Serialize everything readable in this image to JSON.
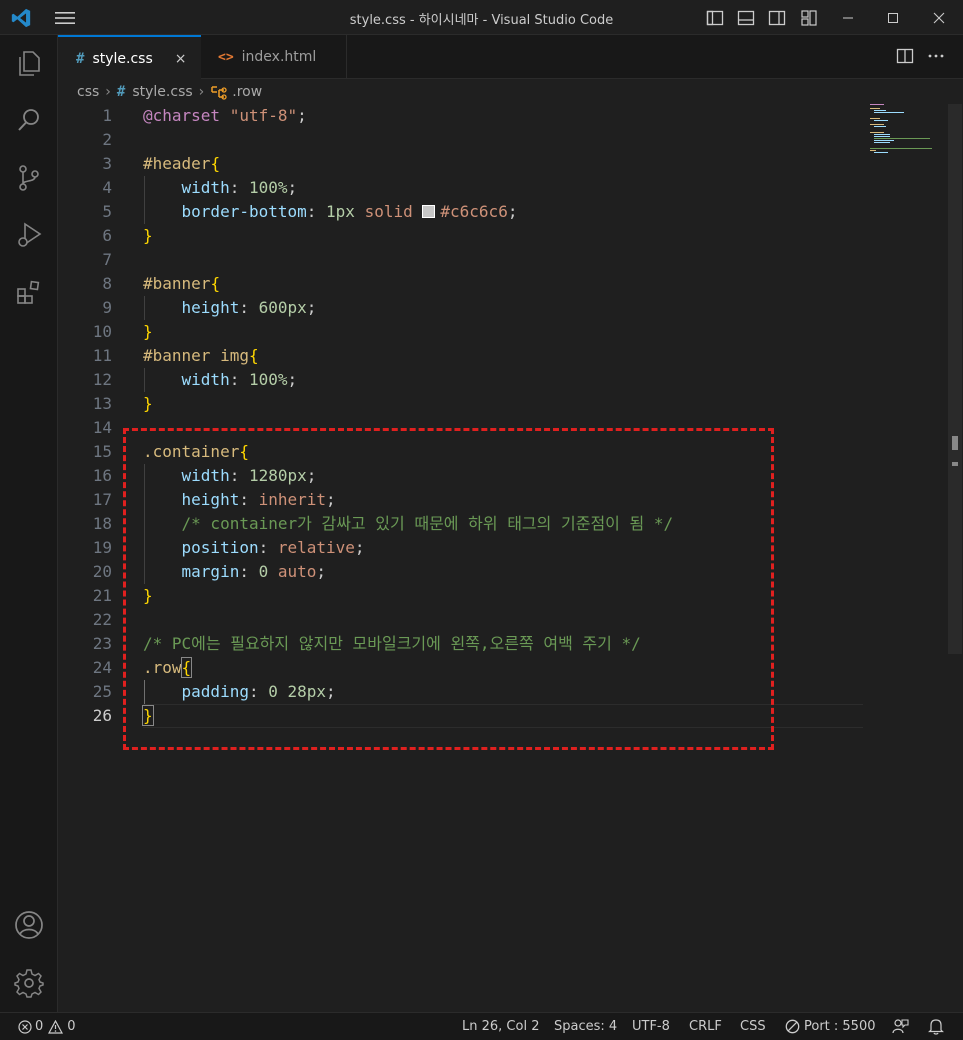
{
  "window": {
    "title": "style.css - 하이시네마 - Visual Studio Code"
  },
  "icons": {
    "app": "vscode-logo-icon",
    "menu": "hamburger-menu-icon",
    "layout": [
      "toggle-primary-sidebar-icon",
      "toggle-panel-icon",
      "toggle-secondary-sidebar-icon",
      "customize-layout-icon"
    ],
    "window": [
      "minimize-icon",
      "maximize-icon",
      "close-icon"
    ],
    "activity": [
      "explorer-icon",
      "search-icon",
      "source-control-icon",
      "run-debug-icon",
      "extensions-icon"
    ],
    "activity_bottom": [
      "accounts-icon",
      "settings-gear-icon"
    ]
  },
  "tabs": [
    {
      "icon": "#",
      "label": "style.css",
      "close": "×",
      "active": true
    },
    {
      "icon": "<>",
      "label": "index.html",
      "active": false
    }
  ],
  "breadcrumb": {
    "folder": "css",
    "file_icon": "#",
    "file": "style.css",
    "symbol": ".row"
  },
  "editor": {
    "current_line": 26,
    "lines": [
      {
        "n": "1"
      },
      {
        "n": "2"
      },
      {
        "n": "3"
      },
      {
        "n": "4"
      },
      {
        "n": "5"
      },
      {
        "n": "6"
      },
      {
        "n": "7"
      },
      {
        "n": "8"
      },
      {
        "n": "9"
      },
      {
        "n": "10"
      },
      {
        "n": "11"
      },
      {
        "n": "12"
      },
      {
        "n": "13"
      },
      {
        "n": "14"
      },
      {
        "n": "15"
      },
      {
        "n": "16"
      },
      {
        "n": "17"
      },
      {
        "n": "18"
      },
      {
        "n": "19"
      },
      {
        "n": "20"
      },
      {
        "n": "21"
      },
      {
        "n": "22"
      },
      {
        "n": "23"
      },
      {
        "n": "24"
      },
      {
        "n": "25"
      },
      {
        "n": "26"
      }
    ],
    "code": {
      "l1": {
        "at": "@charset",
        "sp": " ",
        "str": "\"utf-8\"",
        "end": ";"
      },
      "l3": {
        "sel": "#header",
        "brace": "{"
      },
      "l4": {
        "prop": "width",
        "colon": ": ",
        "num": "100%",
        "end": ";"
      },
      "l5": {
        "prop": "border-bottom",
        "colon": ": ",
        "num": "1px",
        "sp": " ",
        "val": "solid",
        "sp2": " ",
        "hex": "#c6c6c6",
        "end": ";"
      },
      "l6": {
        "brace": "}"
      },
      "l8": {
        "sel": "#banner",
        "brace": "{"
      },
      "l9": {
        "prop": "height",
        "colon": ": ",
        "num": "600px",
        "end": ";"
      },
      "l10": {
        "brace": "}"
      },
      "l11": {
        "sel": "#banner img",
        "brace": "{"
      },
      "l12": {
        "prop": "width",
        "colon": ": ",
        "num": "100%",
        "end": ";"
      },
      "l13": {
        "brace": "}"
      },
      "l15": {
        "sel": ".container",
        "brace": "{"
      },
      "l16": {
        "prop": "width",
        "colon": ": ",
        "num": "1280px",
        "end": ";"
      },
      "l17": {
        "prop": "height",
        "colon": ": ",
        "val": "inherit",
        "end": ";"
      },
      "l18": {
        "cmt": "/* container가 감싸고 있기 때문에 하위 태그의 기준점이 됨 */"
      },
      "l19": {
        "prop": "position",
        "colon": ": ",
        "val": "relative",
        "end": ";"
      },
      "l20": {
        "prop": "margin",
        "colon": ": ",
        "num": "0",
        "sp": " ",
        "val": "auto",
        "end": ";"
      },
      "l21": {
        "brace": "}"
      },
      "l23": {
        "cmt": "/* PC에는 필요하지 않지만 모바일크기에 왼쪽,오른쪽 여백 주기 */"
      },
      "l24": {
        "sel": ".row",
        "brace": "{"
      },
      "l25": {
        "prop": "padding",
        "colon": ": ",
        "num": "0 28px",
        "end": ";"
      },
      "l26": {
        "brace": "}"
      }
    },
    "swatch_color": "#c6c6c6",
    "annotation_color": "#e0201f"
  },
  "status": {
    "errors": "0",
    "warnings": "0",
    "position": "Ln 26, Col 2",
    "spaces": "Spaces: 4",
    "encoding": "UTF-8",
    "eol": "CRLF",
    "language": "CSS",
    "port": "Port : 5500"
  }
}
